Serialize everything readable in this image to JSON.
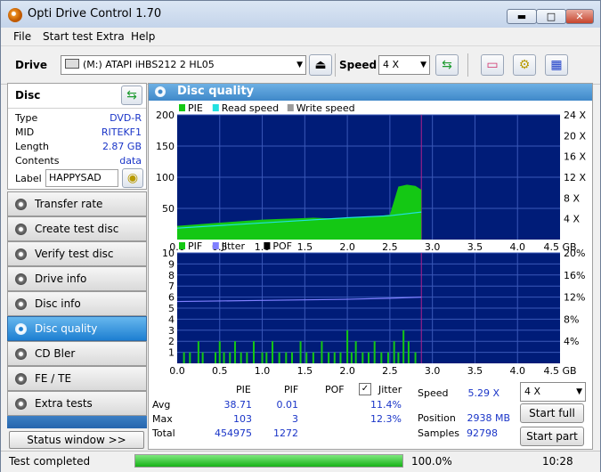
{
  "window": {
    "title": "Opti Drive Control 1.70"
  },
  "menu": [
    {
      "label": "File"
    },
    {
      "label": "Start test"
    },
    {
      "label": "Extra"
    },
    {
      "label": "Help"
    }
  ],
  "toolbar": {
    "drive_label": "Drive",
    "drive_value": "(M:)   ATAPI iHBS212   2 HL05",
    "speed_label": "Speed",
    "speed_value": "4 X"
  },
  "disc": {
    "header": "Disc",
    "rows": [
      {
        "label": "Type",
        "value": "DVD-R"
      },
      {
        "label": "MID",
        "value": "RITEKF1"
      },
      {
        "label": "Length",
        "value": "2.87 GB"
      },
      {
        "label": "Contents",
        "value": "data"
      }
    ],
    "label_caption": "Label",
    "label_value": "HAPPYSAD"
  },
  "nav": [
    {
      "label": "Transfer rate"
    },
    {
      "label": "Create test disc"
    },
    {
      "label": "Verify test disc"
    },
    {
      "label": "Drive info"
    },
    {
      "label": "Disc info"
    },
    {
      "label": "Disc quality"
    },
    {
      "label": "CD Bler"
    },
    {
      "label": "FE / TE"
    },
    {
      "label": "Extra tests"
    }
  ],
  "status_window_label": "Status window >>",
  "panel": {
    "title": "Disc quality"
  },
  "chart_data": [
    {
      "type": "area",
      "legend": [
        "PIE",
        "Read speed",
        "Write speed"
      ],
      "colors": {
        "PIE": "#14c814",
        "Read speed": "#22e0e0",
        "Write speed": "#9a9a9a",
        "background": "#001c78",
        "grid": "#3a58b8"
      },
      "x_ticks": [
        "0.0",
        "0.5",
        "1.0",
        "1.5",
        "2.0",
        "2.5",
        "3.0",
        "3.5",
        "4.0",
        "4.5 GB"
      ],
      "y_left_ticks": [
        "200",
        "150",
        "100",
        "50"
      ],
      "y_right_ticks": [
        "24 X",
        "20 X",
        "16 X",
        "12 X",
        "8 X",
        "4 X"
      ],
      "xlim": [
        0,
        4.5
      ],
      "ylim": [
        0,
        200
      ],
      "y2lim": [
        0,
        24
      ],
      "end_marker_x": 2.87,
      "series": [
        {
          "name": "PIE",
          "x": [
            0.0,
            0.2,
            0.4,
            0.6,
            0.8,
            1.0,
            1.2,
            1.4,
            1.6,
            1.8,
            2.0,
            2.2,
            2.4,
            2.5,
            2.6,
            2.7,
            2.8,
            2.87
          ],
          "values": [
            22,
            24,
            26,
            28,
            30,
            32,
            33,
            34,
            35,
            34,
            35,
            36,
            38,
            40,
            85,
            88,
            86,
            80
          ]
        },
        {
          "name": "Read speed",
          "x": [
            0.0,
            0.5,
            1.0,
            1.5,
            2.0,
            2.5,
            2.87
          ],
          "values": [
            2.2,
            2.7,
            3.2,
            3.7,
            4.2,
            4.6,
            5.29
          ]
        }
      ]
    },
    {
      "type": "bar",
      "legend": [
        "PIF",
        "Jitter",
        "POF"
      ],
      "colors": {
        "PIF": "#14c814",
        "Jitter": "#8080ff",
        "POF": "#000000",
        "background": "#001c78",
        "grid": "#3a58b8"
      },
      "x_ticks": [
        "0.0",
        "0.5",
        "1.0",
        "1.5",
        "2.0",
        "2.5",
        "3.0",
        "3.5",
        "4.0",
        "4.5 GB"
      ],
      "y_left_ticks": [
        "10",
        "9",
        "8",
        "7",
        "6",
        "5",
        "4",
        "3",
        "2",
        "1"
      ],
      "y_right_ticks": [
        "20%",
        "16%",
        "12%",
        "8%",
        "4%"
      ],
      "xlim": [
        0,
        4.5
      ],
      "ylim": [
        0,
        10
      ],
      "y2lim": [
        0,
        20
      ],
      "end_marker_x": 2.87,
      "series": [
        {
          "name": "PIF",
          "x": [
            0.08,
            0.15,
            0.25,
            0.3,
            0.45,
            0.5,
            0.55,
            0.62,
            0.68,
            0.75,
            0.82,
            0.9,
            1.0,
            1.05,
            1.12,
            1.2,
            1.28,
            1.35,
            1.45,
            1.52,
            1.6,
            1.7,
            1.78,
            1.85,
            1.92,
            2.0,
            2.05,
            2.1,
            2.18,
            2.25,
            2.32,
            2.4,
            2.48,
            2.55,
            2.6,
            2.66,
            2.72,
            2.8
          ],
          "values": [
            1,
            1,
            2,
            1,
            1,
            2,
            1,
            1,
            2,
            1,
            1,
            2,
            1,
            1,
            2,
            1,
            1,
            1,
            2,
            1,
            1,
            2,
            1,
            1,
            1,
            3,
            1,
            2,
            1,
            1,
            2,
            1,
            1,
            2,
            1,
            3,
            2,
            1
          ]
        },
        {
          "name": "Jitter",
          "x": [
            0.0,
            0.5,
            1.0,
            1.5,
            2.0,
            2.5,
            2.87
          ],
          "values": [
            11.2,
            11.3,
            11.4,
            11.5,
            11.6,
            11.8,
            12.0
          ]
        }
      ]
    }
  ],
  "stats": {
    "headers": [
      "PIE",
      "PIF",
      "POF",
      "Jitter"
    ],
    "rows": [
      {
        "label": "Avg",
        "pie": "38.71",
        "pif": "0.01",
        "jitter": "11.4%"
      },
      {
        "label": "Max",
        "pie": "103",
        "pif": "3",
        "jitter": "12.3%"
      },
      {
        "label": "Total",
        "pie": "454975",
        "pif": "1272",
        "jitter": ""
      }
    ],
    "speed_label": "Speed",
    "speed_value": "5.29 X",
    "position_label": "Position",
    "position_value": "2938 MB",
    "samples_label": "Samples",
    "samples_value": "92798",
    "speed_select": "4 X",
    "start_full": "Start full",
    "start_part": "Start part"
  },
  "statusbar": {
    "status": "Test completed",
    "progress_percent": 100,
    "progress_text": "100.0%",
    "time": "10:28"
  }
}
